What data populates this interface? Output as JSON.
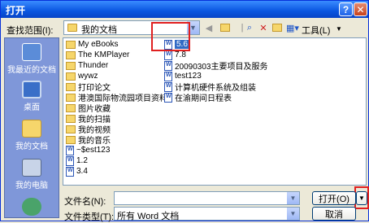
{
  "window": {
    "title": "打开"
  },
  "toolbar": {
    "look_in_label": "查找范围(I):",
    "look_in_value": "我的文档",
    "tools_label": "工具(L)"
  },
  "places": [
    {
      "label": "我最近的文档",
      "icon": "recent-documents-icon"
    },
    {
      "label": "桌面",
      "icon": "desktop-icon"
    },
    {
      "label": "我的文档",
      "icon": "my-documents-icon"
    },
    {
      "label": "我的电脑",
      "icon": "my-computer-icon"
    }
  ],
  "files": {
    "col1": [
      {
        "name": "My eBooks",
        "type": "folder"
      },
      {
        "name": "The KMPlayer",
        "type": "folder"
      },
      {
        "name": "Thunder",
        "type": "folder"
      },
      {
        "name": "wywz",
        "type": "folder"
      },
      {
        "name": "打印论文",
        "type": "folder"
      },
      {
        "name": "港澳国际物流园项目资料",
        "type": "folder"
      },
      {
        "name": "图片收藏",
        "type": "folder"
      },
      {
        "name": "我的扫描",
        "type": "folder"
      },
      {
        "name": "我的视频",
        "type": "folder"
      },
      {
        "name": "我的音乐",
        "type": "folder"
      },
      {
        "name": "~$est123",
        "type": "doc"
      },
      {
        "name": "1.2",
        "type": "doc"
      },
      {
        "name": "3.4",
        "type": "doc"
      }
    ],
    "col2": [
      {
        "name": "5.6",
        "type": "doc",
        "selected": true
      },
      {
        "name": "7.8",
        "type": "doc"
      },
      {
        "name": "20090303主要项目及服务",
        "type": "doc"
      },
      {
        "name": "test123",
        "type": "doc"
      },
      {
        "name": "计算机硬件系统及组装",
        "type": "doc"
      },
      {
        "name": "在渝期间日程表",
        "type": "doc"
      }
    ]
  },
  "footer": {
    "filename_label": "文件名(N):",
    "filename_value": "",
    "filetype_label": "文件类型(T):",
    "filetype_value": "所有 Word 文档",
    "open_label": "打开(O)",
    "cancel_label": "取消"
  }
}
